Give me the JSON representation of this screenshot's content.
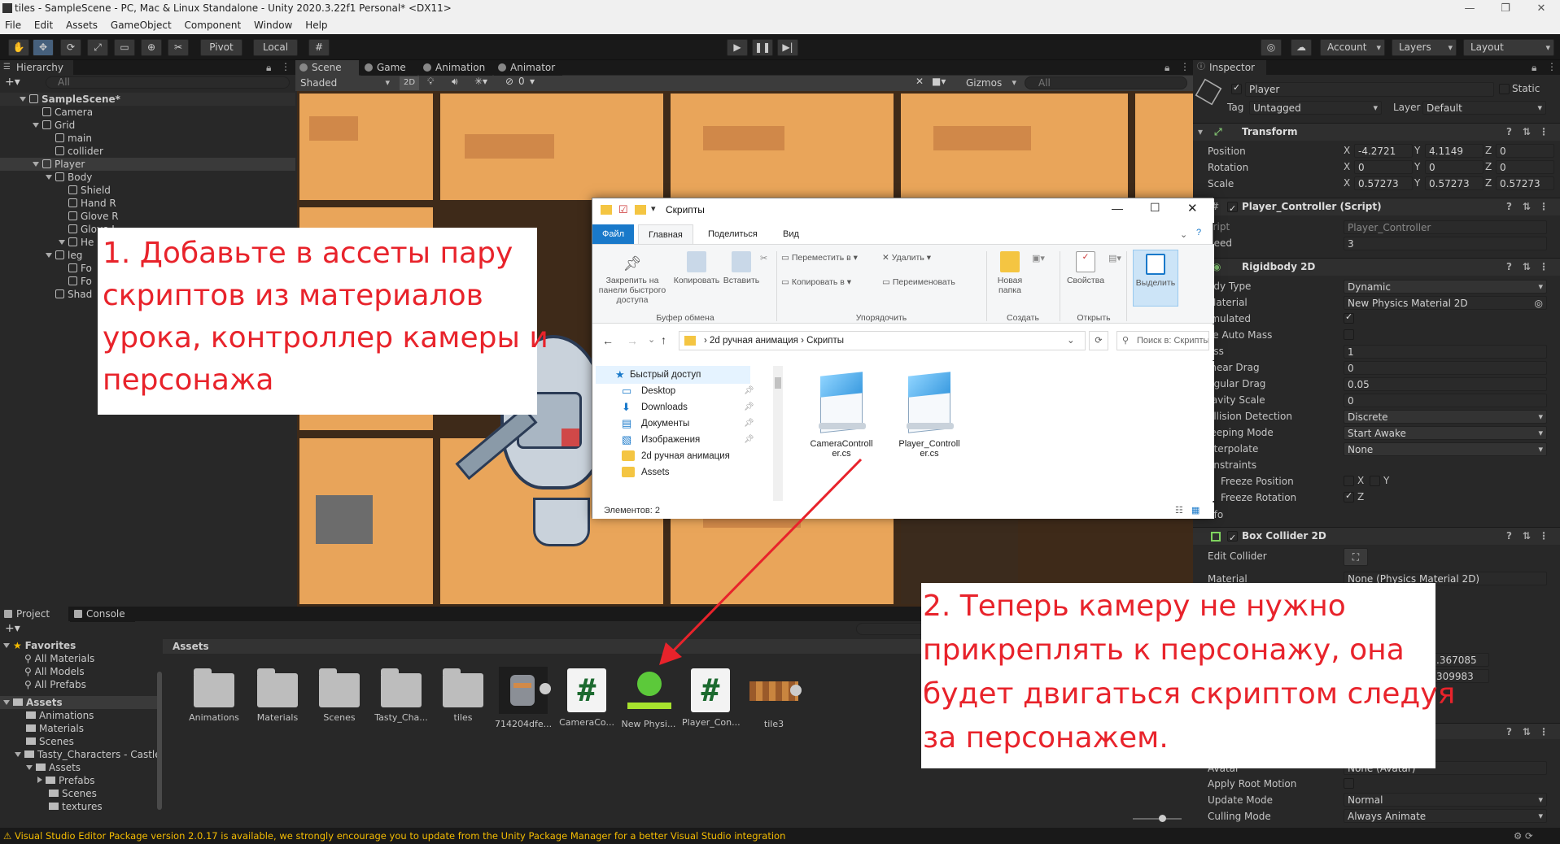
{
  "window": {
    "title": "tiles - SampleScene - PC, Mac & Linux Standalone - Unity 2020.3.22f1 Personal* <DX11>"
  },
  "menu": [
    "File",
    "Edit",
    "Assets",
    "GameObject",
    "Component",
    "Window",
    "Help"
  ],
  "toolbar": {
    "pivot": "Pivot",
    "local": "Local",
    "account": "Account",
    "layers": "Layers",
    "layout": "Layout"
  },
  "hierarchy": {
    "tab": "Hierarchy",
    "search_placeholder": "All",
    "items": [
      {
        "label": "SampleScene*",
        "depth": 0
      },
      {
        "label": "Camera",
        "depth": 1
      },
      {
        "label": "Grid",
        "depth": 1
      },
      {
        "label": "main",
        "depth": 2
      },
      {
        "label": "collider",
        "depth": 2
      },
      {
        "label": "Player",
        "depth": 1
      },
      {
        "label": "Body",
        "depth": 2
      },
      {
        "label": "Shield",
        "depth": 3
      },
      {
        "label": "Hand R",
        "depth": 3
      },
      {
        "label": "Glove R",
        "depth": 3
      },
      {
        "label": "Glove L",
        "depth": 3
      },
      {
        "label": "He",
        "depth": 3
      },
      {
        "label": "leg",
        "depth": 2
      },
      {
        "label": "Fo",
        "depth": 3
      },
      {
        "label": "Fo",
        "depth": 3
      },
      {
        "label": "Shad",
        "depth": 2
      }
    ]
  },
  "scene_tabs": {
    "scene": "Scene",
    "game": "Game",
    "animation": "Animation",
    "animator": "Animator",
    "shading": "Shaded",
    "mode2d": "2D",
    "gizmos": "Gizmos",
    "search_placeholder": "All",
    "count": "0"
  },
  "explorer": {
    "title": "Скрипты",
    "tabs": [
      "Файл",
      "Главная",
      "Поделиться",
      "Вид"
    ],
    "ribbon": {
      "pin": "Закрепить на панели быстрого доступа",
      "copy": "Копировать",
      "paste": "Вставить",
      "move": "Переместить в",
      "copy_to": "Копировать в",
      "delete": "Удалить",
      "rename": "Переименовать",
      "new_folder": "Новая папка",
      "properties": "Свойства",
      "select": "Выделить",
      "group_clipboard": "Буфер обмена",
      "group_organize": "Упорядочить",
      "group_create": "Создать",
      "group_open": "Открыть"
    },
    "path": [
      "2d ручная анимация",
      "Скрипты"
    ],
    "search_placeholder": "Поиск в: Скрипты",
    "nav": [
      {
        "label": "Быстрый доступ",
        "icon": "star-icon"
      },
      {
        "label": "Desktop",
        "icon": "desktop-icon"
      },
      {
        "label": "Downloads",
        "icon": "download-icon"
      },
      {
        "label": "Документы",
        "icon": "document-icon"
      },
      {
        "label": "Изображения",
        "icon": "image-icon"
      },
      {
        "label": "2d ручная анимация",
        "icon": "folder-icon"
      },
      {
        "label": "Assets",
        "icon": "folder-icon"
      }
    ],
    "files": [
      {
        "name": "CameraController.cs",
        "line1": "CameraControll",
        "line2": "er.cs"
      },
      {
        "name": "Player_Controller.cs",
        "line1": "Player_Controll",
        "line2": "er.cs"
      }
    ],
    "status": "Элементов: 2"
  },
  "annotations": {
    "a1_lines": [
      "1. Добавьте в ассеты пару",
      "скриптов из материалов",
      "урока, контроллер камеры и",
      "персонажа"
    ],
    "a2_lines": [
      "2. Теперь камеру не нужно",
      "прикреплять к персонажу, она",
      "будет двигаться скриптом следуя",
      "за персонажем."
    ],
    "arrow_color": "#e8232b"
  },
  "project": {
    "tab_project": "Project",
    "tab_console": "Console",
    "favorites": "Favorites",
    "fav_items": [
      "All Materials",
      "All Models",
      "All Prefabs"
    ],
    "assets_root": "Assets",
    "tree": [
      "Animations",
      "Materials",
      "Scenes",
      "Tasty_Characters - Castle",
      "Assets",
      "Prefabs",
      "Scenes",
      "textures"
    ],
    "breadcrumb": "Assets",
    "assets": [
      {
        "label": "Animations",
        "kind": "folder"
      },
      {
        "label": "Materials",
        "kind": "folder"
      },
      {
        "label": "Scenes",
        "kind": "folder"
      },
      {
        "label": "Tasty_Cha...",
        "kind": "folder"
      },
      {
        "label": "tiles",
        "kind": "folder"
      },
      {
        "label": "714204dfe...",
        "kind": "sprite"
      },
      {
        "label": "CameraCo...",
        "kind": "script"
      },
      {
        "label": "New Physi...",
        "kind": "physics"
      },
      {
        "label": "Player_Con...",
        "kind": "script"
      },
      {
        "label": "tile3",
        "kind": "tile"
      }
    ]
  },
  "inspector": {
    "tab": "Inspector",
    "object_name": "Player",
    "static": "Static",
    "tag_label": "Tag",
    "tag": "Untagged",
    "layer_label": "Layer",
    "layer": "Default",
    "transform": {
      "header": "Transform",
      "position_label": "Position",
      "position": [
        "-4.2721",
        "4.1149",
        "0"
      ],
      "rotation_label": "Rotation",
      "rotation": [
        "0",
        "0",
        "0"
      ],
      "scale_label": "Scale",
      "scale": [
        "0.57273",
        "0.57273",
        "0.57273"
      ]
    },
    "player_controller": {
      "header": "Player_Controller (Script)",
      "script_label": "cript",
      "script": "Player_Controller",
      "speed_label": "peed",
      "speed": "3"
    },
    "rigidbody": {
      "header": "Rigidbody 2D",
      "rows": [
        {
          "label": "ody Type",
          "value": "Dynamic",
          "kind": "dropdown"
        },
        {
          "label": "Material",
          "value": "New Physics Material 2D",
          "kind": "object"
        },
        {
          "label": "imulated",
          "value": "",
          "kind": "check-on"
        },
        {
          "label": "se Auto Mass",
          "value": "",
          "kind": "check-off"
        },
        {
          "label": "ass",
          "value": "1",
          "kind": "field"
        },
        {
          "label": "inear Drag",
          "value": "0",
          "kind": "field"
        },
        {
          "label": "ngular Drag",
          "value": "0.05",
          "kind": "field"
        },
        {
          "label": "ravity Scale",
          "value": "0",
          "kind": "field"
        },
        {
          "label": "ollision Detection",
          "value": "Discrete",
          "kind": "dropdown"
        },
        {
          "label": "leeping Mode",
          "value": "Start Awake",
          "kind": "dropdown"
        },
        {
          "label": "nterpolate",
          "value": "None",
          "kind": "dropdown"
        },
        {
          "label": "onstraints",
          "value": "",
          "kind": "none"
        }
      ],
      "freeze_position": "Freeze Position",
      "freeze_rotation": "Freeze Rotation",
      "axis_x": "X",
      "axis_y": "Y",
      "axis_z": "Z",
      "info": "nfo"
    },
    "box_collider": {
      "header": "Box Collider 2D",
      "edit_collider": "Edit Collider",
      "material_label": "Material",
      "material": "None (Physics Material 2D)",
      "offset_x": ".367085",
      "offset_y": "309983"
    },
    "animator": {
      "avatar_label": "Avatar",
      "avatar": "None (Avatar)",
      "apply_root_motion": "Apply Root Motion",
      "update_mode_label": "Update Mode",
      "update_mode": "Normal",
      "culling_mode_label": "Culling Mode",
      "culling_mode": "Always Animate"
    }
  },
  "statusbar": "Visual Studio Editor Package version 2.0.17 is available, we strongly encourage you to update from the Unity Package Manager for a better Visual Studio integration",
  "colors": {
    "accent": "#2c5d87",
    "annotation": "#e8232b",
    "warning": "#f4bc02"
  }
}
